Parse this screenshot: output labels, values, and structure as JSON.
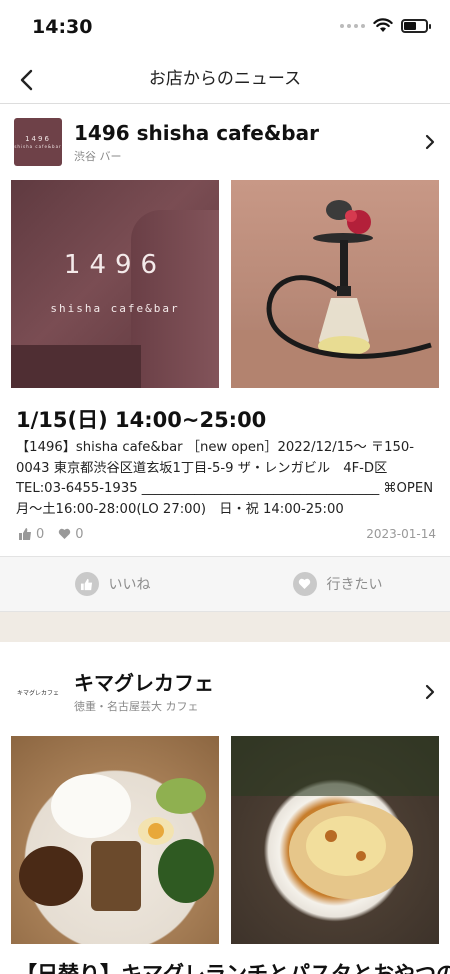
{
  "status_bar": {
    "time": "14:30"
  },
  "nav": {
    "title": "お店からのニュース"
  },
  "post1": {
    "shop_logo_line1": "1496",
    "shop_logo_line2": "shisha cafe&bar",
    "shop_name": "1496 shisha cafe&bar",
    "shop_sub": "渋谷 バー",
    "photo_brand_title": "1496",
    "photo_brand_sub": "shisha cafe&bar",
    "title": "1/15(日) 14:00~25:00",
    "body": "【1496】shisha cafe&bar ［new open］2022/12/15～ 〒150-0043 東京都渋谷区道玄坂1丁目-5-9 ザ・レンガビル　4F-D区 TEL:03-6455-1935 ____________________________________ ⌘OPEN 月～土16:00-28:00(LO 27:00)　日・祝 14:00-25:00",
    "like_count": "0",
    "want_count": "0",
    "date": "2023-01-14"
  },
  "actions": {
    "like_label": "いいね",
    "want_label": "行きたい"
  },
  "post2": {
    "shop_logo_text": "キマグレカフェ",
    "shop_name": "キマグレカフェ",
    "shop_sub": "徳重・名古屋芸大 カフェ",
    "title": "【日替り】キマグレランチとパスタとおやつの"
  }
}
